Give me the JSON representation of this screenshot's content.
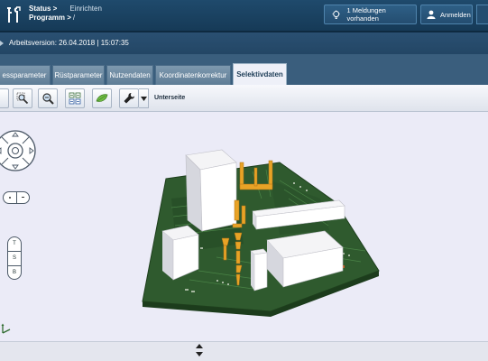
{
  "header": {
    "crumb1_label": "Status >",
    "crumb1_value": "Einrichten",
    "crumb2_label": "Programm >",
    "crumb2_value": "/",
    "messages_label": "1 Meldungen vorhanden",
    "login_label": "Anmelden"
  },
  "version_bar": {
    "text": "Arbeitsversion: 26.04.2018 | 15:07:35"
  },
  "tabs": [
    {
      "label": "essparameter",
      "active": false
    },
    {
      "label": "Rüstparameter",
      "active": false
    },
    {
      "label": "Nutzendaten",
      "active": false
    },
    {
      "label": "Koordinatenkorrektur",
      "active": false
    },
    {
      "label": "Selektivdaten",
      "active": true
    }
  ],
  "toolbar": {
    "buttons": [
      "partial-button",
      "zoom-area-icon",
      "zoom-icon",
      "grid-view-icon",
      "leaf-icon",
      "wrench-icon"
    ],
    "page_label": "Unterseite"
  },
  "viewport": {
    "view_buttons": [
      "T",
      "S",
      "B"
    ]
  },
  "colors": {
    "header_bg": "#1f4a6c",
    "tab_active_bg": "#eef0f8",
    "viewport_bg": "#ebebf7",
    "pcb_green": "#2f5a2e",
    "nozzle_orange": "#e8a326"
  }
}
